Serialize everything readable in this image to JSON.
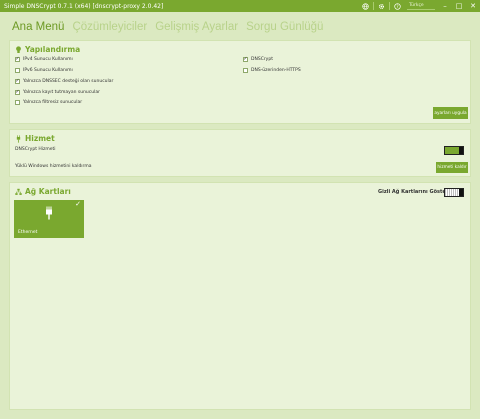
{
  "window": {
    "title": "Simple DNSCrypt 0.7.1 (x64) [dnscrypt-proxy 2.0.42]",
    "search_placeholder": "Türkçe",
    "toolbar_icons": [
      "globe-icon",
      "gear-icon",
      "help-icon"
    ]
  },
  "nav": {
    "tabs": [
      {
        "label": "Ana Menü",
        "active": true
      },
      {
        "label": "Çözümleyiciler",
        "active": false
      },
      {
        "label": "Gelişmiş Ayarlar",
        "active": false
      },
      {
        "label": "Sorgu Günlüğü",
        "active": false
      }
    ]
  },
  "config": {
    "title": "Yapılandırma",
    "options_left": [
      {
        "label": "IPv4 Sunucu Kullanımı",
        "checked": true
      },
      {
        "label": "IPv6 Sunucu Kullanımı",
        "checked": false
      },
      {
        "label": "Yalnızca DNSSEC desteği olan sunucular",
        "checked": true
      },
      {
        "label": "Yalnızca kayıt tutmayan sunucular",
        "checked": true
      },
      {
        "label": "Yalnızca filtresiz sunucular",
        "checked": false
      }
    ],
    "options_right": [
      {
        "label": "DNSCrypt",
        "checked": true
      },
      {
        "label": "DNS-üzerinden-HTTPS",
        "checked": false
      }
    ],
    "apply_button": "ayarları uygula"
  },
  "service": {
    "title": "Hizmet",
    "service_label": "DNSCrypt Hizmeti",
    "service_enabled": true,
    "uninstall_label": "Yüklü Windows hizmetini kaldırma",
    "uninstall_button": "hizmeti kaldır"
  },
  "adapters": {
    "title": "Ağ Kartları",
    "show_hidden_label": "Gizli Ağ Kartlarını Göster",
    "show_hidden_enabled": false,
    "items": [
      {
        "name": "Ethernet",
        "selected": true
      }
    ]
  },
  "colors": {
    "accent": "#7aa82f",
    "background": "#dbe9c1",
    "panel": "#eaf3d9"
  }
}
